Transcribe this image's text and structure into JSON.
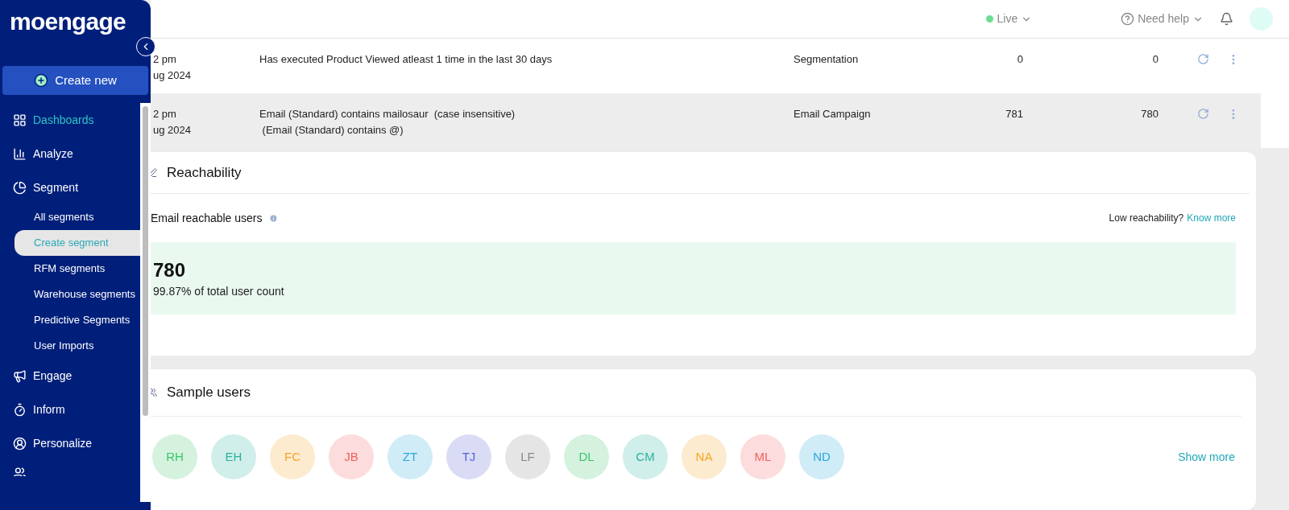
{
  "logo": "moengage",
  "sidebar": {
    "create_button": "Create new",
    "items": [
      {
        "label": "Dashboards",
        "kind": "dashboard",
        "selected": true
      },
      {
        "label": "Analyze",
        "kind": "bars",
        "selected": false
      },
      {
        "label": "Segment",
        "kind": "pie",
        "selected": false,
        "children": [
          {
            "label": "All segments",
            "selected": false
          },
          {
            "label": "Create segment",
            "selected": true
          },
          {
            "label": "RFM segments",
            "selected": false
          },
          {
            "label": "Warehouse segments",
            "selected": false
          },
          {
            "label": "Predictive Segments",
            "selected": false
          },
          {
            "label": "User Imports",
            "selected": false
          }
        ]
      },
      {
        "label": "Engage",
        "kind": "megaphone",
        "selected": false
      },
      {
        "label": "Inform",
        "kind": "stopwatch",
        "selected": false
      },
      {
        "label": "Personalize",
        "kind": "target",
        "selected": false
      }
    ]
  },
  "header": {
    "status": "Live",
    "help": "Need help"
  },
  "table": {
    "rows": [
      {
        "time": "2 pm",
        "date": "ug 2024",
        "description": [
          "Has executed Product Viewed atleast 1 time in the last 30 days"
        ],
        "type": "Segmentation",
        "count_1": "0",
        "count_2": "0",
        "selected": false
      },
      {
        "time": "2 pm",
        "date": "ug 2024",
        "description": [
          "Email (Standard) contains mailosaur  (case insensitive)",
          " (Email (Standard) contains @)"
        ],
        "type": "Email Campaign",
        "count_1": "781",
        "count_2": "780",
        "selected": true
      }
    ]
  },
  "reachability": {
    "title": "Reachability",
    "label": "Email reachable users",
    "hint": "Low reachability?",
    "link": "Know more",
    "count": "780",
    "share": "99.87% of total user count"
  },
  "sample_users": {
    "title": "Sample users",
    "show_more": "Show more",
    "users": [
      {
        "initials": "RH",
        "color": "#3cc46a"
      },
      {
        "initials": "EH",
        "color": "#2bb3a0"
      },
      {
        "initials": "FC",
        "color": "#f5a623"
      },
      {
        "initials": "JB",
        "color": "#f0625f"
      },
      {
        "initials": "ZT",
        "color": "#2aa8dc"
      },
      {
        "initials": "TJ",
        "color": "#5560d8"
      },
      {
        "initials": "LF",
        "color": "#888888"
      },
      {
        "initials": "DL",
        "color": "#3cc46a"
      },
      {
        "initials": "CM",
        "color": "#2bb3a0"
      },
      {
        "initials": "NA",
        "color": "#f5a623"
      },
      {
        "initials": "ML",
        "color": "#f0625f"
      },
      {
        "initials": "ND",
        "color": "#2aa8dc"
      }
    ]
  }
}
